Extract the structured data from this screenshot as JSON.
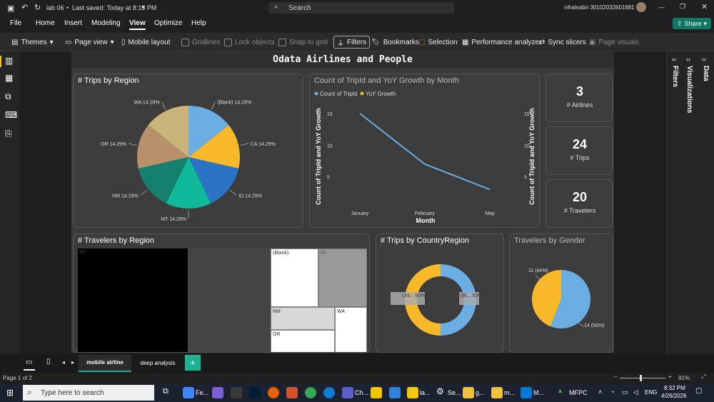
{
  "titlebar": {
    "file": "lab 06",
    "saved": "Last saved: Today at 8:13 PM",
    "search": "Search",
    "user": "nihalsabri 30102032601881"
  },
  "menu": {
    "items": [
      "File",
      "Home",
      "Insert",
      "Modeling",
      "View",
      "Optimize",
      "Help"
    ],
    "active": "View",
    "share": "Share"
  },
  "ribbon": {
    "themes": "Themes",
    "page_view": "Page view",
    "mobile_layout": "Mobile layout",
    "gridlines": "Gridlines",
    "lock_objects": "Lock objects",
    "snap_to_grid": "Snap to grid",
    "filters": "Filters",
    "bookmarks": "Bookmarks",
    "selection": "Selection",
    "performance": "Performance analyzer",
    "sync_slicers": "Sync slicers",
    "page_visuals": "Page visuals"
  },
  "report": {
    "title": "Odata Airlines and People"
  },
  "trips_by_region": {
    "title": "# Trips by Region",
    "labels": [
      "(Blank) 14.29%",
      "CA 14.29%",
      "ID 14.29%",
      "MT 14.29%",
      "NM 14.29%",
      "OR 14.29%",
      "WA 14.29%"
    ],
    "colors": [
      "#6aaee4",
      "#f7b82a",
      "#2a73c5",
      "#10b99a",
      "#16806e",
      "#b8906a",
      "#c9b57a"
    ]
  },
  "line_chart": {
    "title": "Count of TripId and YoY Growth by Month",
    "legend": [
      "Count of TripId",
      "YoY Growth"
    ],
    "legend_colors": [
      "#6aaee4",
      "#f7b82a"
    ],
    "xlabel": "Month",
    "ylabel_left": "Count of TripId and YoY Growth",
    "ylabel_right": "Count of TripId and YoY Growth",
    "y_ticks": [
      "15",
      "10",
      "5"
    ],
    "x_ticks": [
      "January",
      "February",
      "May"
    ]
  },
  "cards": [
    {
      "value": "3",
      "label": "# Airlines"
    },
    {
      "value": "24",
      "label": "# Trips"
    },
    {
      "value": "20",
      "label": "# Travelers"
    }
  ],
  "travelers_by_region": {
    "title": "# Travelers by Region",
    "labels": [
      "MT",
      "(Blank)",
      "ID",
      "NM",
      "WA",
      "OR"
    ]
  },
  "trips_by_country": {
    "title": "# Trips by CountryRegion",
    "labels": [
      "Uni... 50%",
      "(Bl... 50%"
    ]
  },
  "gender": {
    "title": "Travelers by Gender",
    "labels": [
      "11 (44%)",
      "14 (56%)"
    ]
  },
  "chart_data": [
    {
      "type": "pie",
      "title": "# Trips by Region",
      "categories": [
        "(Blank)",
        "CA",
        "ID",
        "MT",
        "NM",
        "OR",
        "WA"
      ],
      "values": [
        14.29,
        14.29,
        14.29,
        14.29,
        14.29,
        14.29,
        14.29
      ]
    },
    {
      "type": "line",
      "title": "Count of TripId and YoY Growth by Month",
      "categories": [
        "January",
        "February",
        "May"
      ],
      "series": [
        {
          "name": "Count of TripId",
          "values": [
            15,
            7,
            3
          ]
        }
      ],
      "xlabel": "Month",
      "ylabel": "Count of TripId and YoY Growth"
    },
    {
      "type": "pie",
      "title": "# Trips by CountryRegion",
      "categories": [
        "Uni...",
        "(Bl..."
      ],
      "values": [
        50,
        50
      ]
    },
    {
      "type": "pie",
      "title": "Travelers by Gender",
      "values": [
        11,
        14
      ]
    }
  ],
  "pages": {
    "tabs": [
      "mobile airline",
      "deep analysis"
    ],
    "active": "mobile airline",
    "add": "+"
  },
  "status": {
    "page": "Page 1 of 2",
    "zoom": "91%"
  },
  "taskbar": {
    "search": "Type here to search",
    "apps": [
      "Fe...",
      "Ch...",
      "la...",
      "Se...",
      "g...",
      "m...",
      "M..."
    ],
    "weather": "MFPC",
    "lang": "ENG",
    "time": "8:32 PM",
    "date": "4/26/2026"
  }
}
